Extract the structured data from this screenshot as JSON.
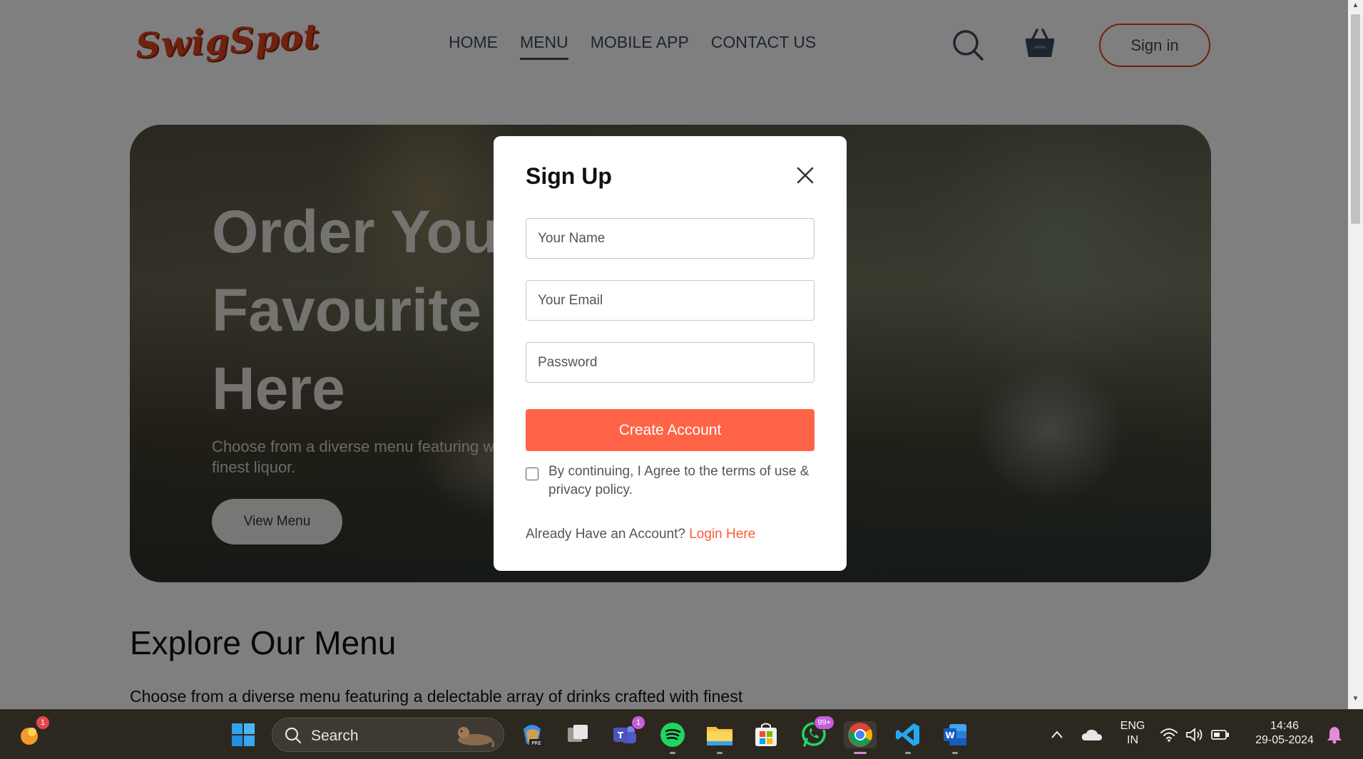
{
  "brand": {
    "logo_text": "SwigSpot",
    "accent_color": "#ff6347"
  },
  "nav": {
    "links": [
      "HOME",
      "MENU",
      "MOBILE APP",
      "CONTACT US"
    ],
    "active": "MENU",
    "signin_label": "Sign in"
  },
  "hero": {
    "title": "Order Your Favourite Here",
    "subtitle": "Choose from a diverse menu featuring with finest liquor.",
    "button_label": "View Menu"
  },
  "explore": {
    "title": "Explore Our Menu",
    "subtitle": "Choose from a diverse menu featuring a delectable array of drinks crafted with finest"
  },
  "modal": {
    "title": "Sign Up",
    "name_placeholder": "Your Name",
    "email_placeholder": "Your Email",
    "password_placeholder": "Password",
    "create_label": "Create Account",
    "agree_text": "By continuing, I Agree to the terms of use & privacy policy.",
    "already_text": "Already Have an Account?",
    "login_label": "Login Here"
  },
  "taskbar": {
    "search_label": "Search",
    "badges": {
      "widgets": "1",
      "teams": "1",
      "whatsapp": "99+"
    },
    "language": "ENG",
    "region": "IN",
    "time": "14:46",
    "date": "29-05-2024"
  }
}
